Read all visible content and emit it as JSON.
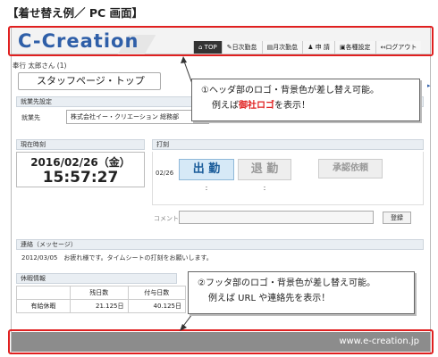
{
  "page_title": "【着せ替え例／ PC 画面】",
  "header": {
    "logo": "C-Creation",
    "nav": [
      "TOP",
      "日次勤怠",
      "月次勤怠",
      "申 請",
      "各種設定",
      "ログアウト"
    ]
  },
  "user_line": "奉行 太郎さん (1)",
  "staff_page_label": "スタッフページ・トップ",
  "work_section": {
    "title": "就業先設定",
    "label": "就業先",
    "value": "株式会社イー・クリエーション 総務部"
  },
  "clock": {
    "title": "現在時刻",
    "date": "2016/02/26（金）",
    "time": "15:57:27"
  },
  "punch": {
    "title": "打刻",
    "date": "02/26",
    "in_label": "出 勤",
    "out_label": "退 勤",
    "request_label": "承認依頼",
    "in_time": ":",
    "out_time": ":",
    "comment_label": "コメント",
    "register_label": "登録"
  },
  "notice": {
    "title": "連絡（メッセージ）",
    "text": "2012/03/05　お疲れ様です。タイムシートの打刻をお願いします。"
  },
  "leave": {
    "title": "休暇情報",
    "headers": [
      "",
      "残日数",
      "付与日数"
    ],
    "rows": [
      [
        "有給休暇",
        "21.125日",
        "40.125日"
      ]
    ]
  },
  "callouts": {
    "header_line1": "①ヘッダ部のロゴ・背景色が差し替え可能。",
    "header_line2a": "例えば",
    "header_line2b": "御社ロゴ",
    "header_line2c": "を表示！",
    "footer_line1": "②フッタ部のロゴ・背景色が差し替え可能。",
    "footer_line2": "例えば URL や連絡先を表示！"
  },
  "footer": {
    "url": "www.e-creation.jp"
  },
  "colors": {
    "highlight": "#e02020",
    "logo": "#2f5fa8",
    "footer_bg": "#8c8c8c"
  }
}
